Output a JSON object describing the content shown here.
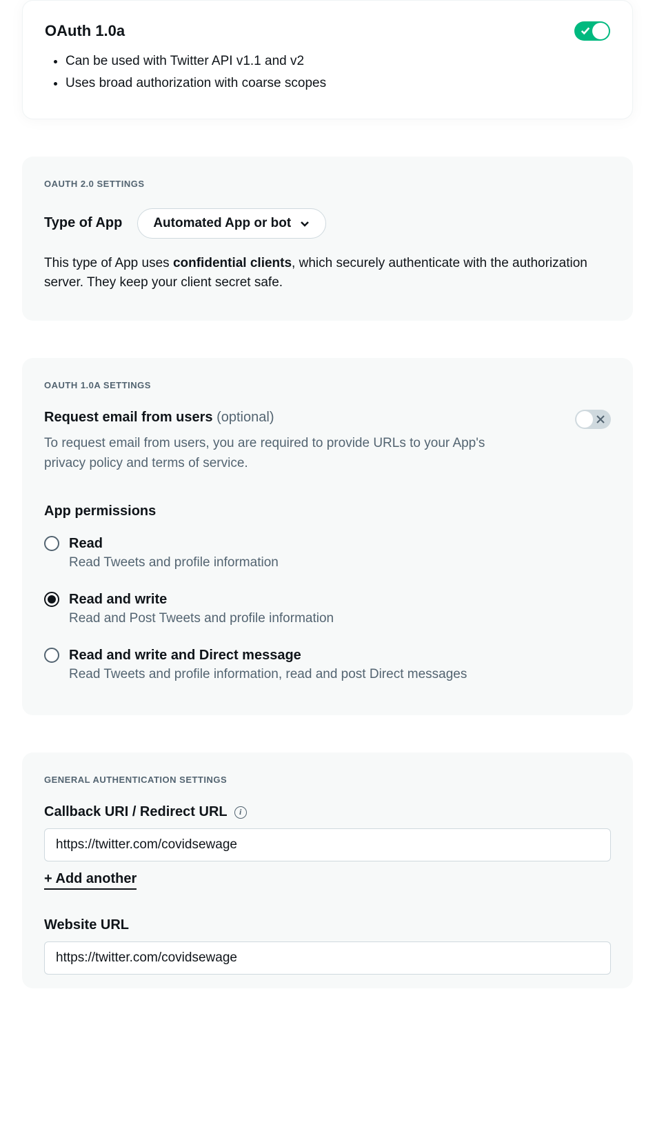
{
  "oauth10a_card": {
    "title": "OAuth 1.0a",
    "bullets": [
      "Can be used with Twitter API v1.1 and v2",
      "Uses broad authorization with coarse scopes"
    ],
    "enabled": true
  },
  "oauth20_settings": {
    "section_label": "OAUTH 2.0 SETTINGS",
    "type_label": "Type of App",
    "type_value": "Automated App or bot",
    "desc_before": "This type of App uses ",
    "desc_bold": "confidential clients",
    "desc_after": ", which securely authenticate with the authorization server. They keep your client secret safe."
  },
  "oauth10a_settings": {
    "section_label": "OAUTH 1.0A SETTINGS",
    "request_email": {
      "title": "Request email from users",
      "optional": "(optional)",
      "desc": "To request email from users, you are required to provide URLs to your App's privacy policy and terms of service.",
      "enabled": false
    },
    "permissions": {
      "title": "App permissions",
      "options": [
        {
          "label": "Read",
          "sub": "Read Tweets and profile information",
          "checked": false
        },
        {
          "label": "Read and write",
          "sub": "Read and Post Tweets and profile information",
          "checked": true
        },
        {
          "label": "Read and write and Direct message",
          "sub": "Read Tweets and profile information, read and post Direct messages",
          "checked": false
        }
      ]
    }
  },
  "general": {
    "section_label": "GENERAL AUTHENTICATION SETTINGS",
    "callback": {
      "label": "Callback URI / Redirect URL",
      "value": "https://twitter.com/covidsewage",
      "add_another": "+ Add another"
    },
    "website": {
      "label": "Website URL",
      "value": "https://twitter.com/covidsewage"
    }
  }
}
